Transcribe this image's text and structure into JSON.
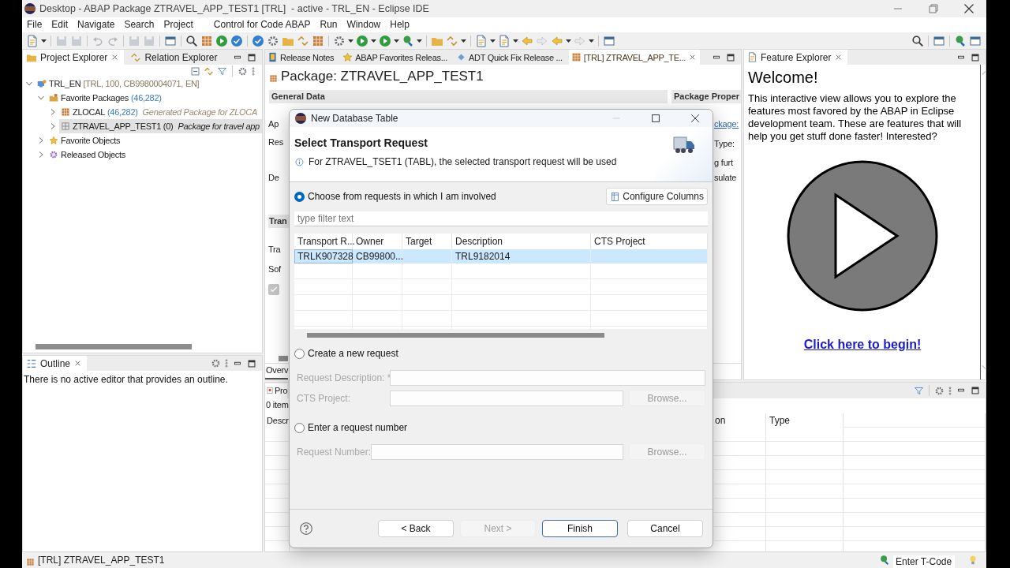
{
  "window": {
    "title": "Desktop - ABAP Package ZTRAVEL_APP_TEST1 [TRL]  - active - TRL_EN - Eclipse IDE"
  },
  "menu": [
    "File",
    "Edit",
    "Navigate",
    "Search",
    "Project",
    "Control for Code ABAP",
    "Run",
    "Window",
    "Help"
  ],
  "project_explorer": {
    "tabs": [
      {
        "label": "Project Explorer",
        "selected": true
      },
      {
        "label": "Relation Explorer",
        "selected": false
      }
    ],
    "tree": [
      {
        "kind": "system",
        "label": "TRL_EN",
        "detail": "[TRL, 100, CB9980004071, EN]",
        "expanded": true,
        "selected": false,
        "children": [
          {
            "kind": "folder",
            "label": "Favorite Packages",
            "detail": "(46,282)",
            "expanded": true,
            "selected": false,
            "children": [
              {
                "kind": "package",
                "label": "ZLOCAL",
                "detail": "(46,282)",
                "description": "Generated Package for ZLOCA",
                "expanded": false,
                "selected": false
              },
              {
                "kind": "package-empty",
                "label": "ZTRAVEL_APP_TEST1 (0)",
                "description": "Package for travel app",
                "expanded": false,
                "selected": true
              }
            ]
          },
          {
            "kind": "star",
            "label": "Favorite Objects",
            "expanded": false,
            "selected": false
          },
          {
            "kind": "gear",
            "label": "Released Objects",
            "expanded": false,
            "selected": false
          }
        ]
      }
    ]
  },
  "outline": {
    "tab": "Outline",
    "message": "There is no active editor that provides an outline."
  },
  "editor": {
    "tabs": [
      {
        "kind": "notes",
        "label": "Release Notes",
        "selected": false
      },
      {
        "kind": "star",
        "label": "ABAP Favorites Releas...",
        "selected": false
      },
      {
        "kind": "quickfix",
        "label": "ADT Quick Fix Release ...",
        "selected": false
      },
      {
        "kind": "package",
        "label": "[TRL] ZTRAVEL_APP_TE...",
        "selected": true
      }
    ],
    "title": "Package: ZTRAVEL_APP_TEST1",
    "sections": [
      "General Data",
      "Package Proper"
    ],
    "left": [
      {
        "kind": "label",
        "text": "Ap"
      },
      {
        "kind": "label",
        "text": "Res"
      },
      {
        "kind": "label",
        "text": "De"
      },
      {
        "kind": "section",
        "text": "Tran"
      },
      {
        "kind": "label",
        "text": "Tra"
      },
      {
        "kind": "label",
        "text": "Sof"
      },
      {
        "kind": "checkbox",
        "checked": true
      }
    ],
    "right": [
      {
        "kind": "link",
        "text": "ckage:"
      },
      {
        "kind": "label",
        "text": "Type:"
      },
      {
        "kind": "label",
        "text": "g furt"
      },
      {
        "kind": "label",
        "text": "sulate"
      }
    ],
    "bottom_tab": {
      "label": "Overv",
      "selected": true
    }
  },
  "feature_explorer": {
    "tab": "Feature Explorer",
    "heading": "Welcome!",
    "text": "This interactive view allows you to explore the features most favored by the ABAP in Eclipse development team. These are features that will help you get stuff done faster! Interested?",
    "link": "Click here to begin!"
  },
  "bottom_panel": {
    "tab": "Pro",
    "count": "0 item",
    "columns": [
      "Descr",
      "on",
      "Type"
    ]
  },
  "status_bar": {
    "text": "[TRL] ZTRAVEL_APP_TEST1",
    "tcode_placeholder": "Enter T-Code"
  },
  "dialog": {
    "title": "New Database Table",
    "heading": "Select Transport Request",
    "message": "For ZTRAVEL_TSET1 (TABL), the selected transport request will be used",
    "options": [
      {
        "kind": "list",
        "label": "Choose from requests in which I am involved",
        "selected": true
      },
      {
        "kind": "new",
        "label": "Create a new request",
        "selected": false
      },
      {
        "kind": "number",
        "label": "Enter a request number",
        "selected": false
      }
    ],
    "configure_button": "Configure Columns",
    "filter": {
      "placeholder": "type filter text"
    },
    "table": {
      "columns": [
        "Transport R...",
        "Owner",
        "Target",
        "Description",
        "CTS Project"
      ],
      "rows": [
        {
          "cells": [
            "TRLK907328",
            "CB99800...",
            null,
            "TRL9182014",
            null
          ],
          "selected": true
        }
      ]
    },
    "new_request_fields": [
      {
        "label": "Request Description: *",
        "disabled": true
      },
      {
        "label": "CTS Project:",
        "disabled": true,
        "button": "Browse..."
      }
    ],
    "number_fields": [
      {
        "label": "Request Number:",
        "disabled": true,
        "button": "Browse..."
      }
    ],
    "buttons": [
      {
        "label": "< Back",
        "disabled": false,
        "default": false
      },
      {
        "label": "Next >",
        "disabled": true,
        "default": false
      },
      {
        "label": "Finish",
        "disabled": false,
        "default": true
      },
      {
        "label": "Cancel",
        "disabled": false,
        "default": false
      }
    ]
  }
}
